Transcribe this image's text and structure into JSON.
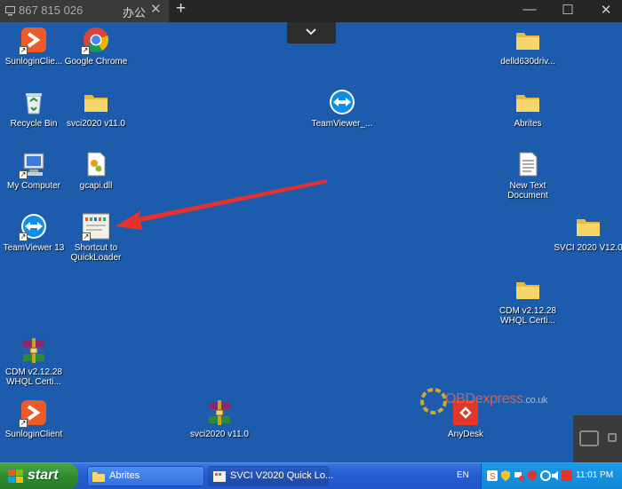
{
  "remote_tab": {
    "session_id": "867 815 026",
    "extra_label": "办公",
    "close_glyph": "✕",
    "add_glyph": "+"
  },
  "window_controls": {
    "minimize": "—",
    "maximize": "☐",
    "close": "✕"
  },
  "desktop": {
    "icons": [
      {
        "label": "SunloginClie...",
        "icon": "sunlogin-icon"
      },
      {
        "label": "Google Chrome",
        "icon": "chrome-icon"
      },
      {
        "label": "delld630driv...",
        "icon": "folder-icon"
      },
      {
        "label": "Recycle Bin",
        "icon": "recycle-bin-icon"
      },
      {
        "label": "svci2020 v11.0",
        "icon": "folder-icon"
      },
      {
        "label": "TeamViewer_...",
        "icon": "teamviewer-icon"
      },
      {
        "label": "Abrites",
        "icon": "folder-icon"
      },
      {
        "label": "My Computer",
        "icon": "my-computer-icon"
      },
      {
        "label": "gcapi.dll",
        "icon": "dll-file-icon"
      },
      {
        "label": "New Text Document",
        "icon": "text-document-icon"
      },
      {
        "label": "TeamViewer 13",
        "icon": "teamviewer-icon"
      },
      {
        "label": "Shortcut to QuickLoader",
        "icon": "quickloader-icon"
      },
      {
        "label": "SVCI 2020 V12.0",
        "icon": "folder-icon"
      },
      {
        "label": "CDM v2.12.28 WHQL Certi...",
        "icon": "folder-icon"
      },
      {
        "label": "CDM v2.12.28 WHQL Certi...",
        "icon": "winrar-archive-icon"
      },
      {
        "label": "SunloginClient",
        "icon": "sunlogin-icon"
      },
      {
        "label": "svci2020 v11.0",
        "icon": "winrar-archive-icon"
      },
      {
        "label": "AnyDesk",
        "icon": "anydesk-icon"
      }
    ],
    "watermark": {
      "text": "OBDexpress",
      "suffix": ".co.uk"
    }
  },
  "taskbar": {
    "start_label": "start",
    "tasks": [
      {
        "label": "Abrites",
        "icon": "folder-icon"
      },
      {
        "label": "SVCI V2020 Quick Lo...",
        "icon": "app-window-icon"
      }
    ],
    "language": "EN",
    "clock": "11:01 PM",
    "accent": "#245ed2",
    "start_color": "#2f8a2f"
  }
}
